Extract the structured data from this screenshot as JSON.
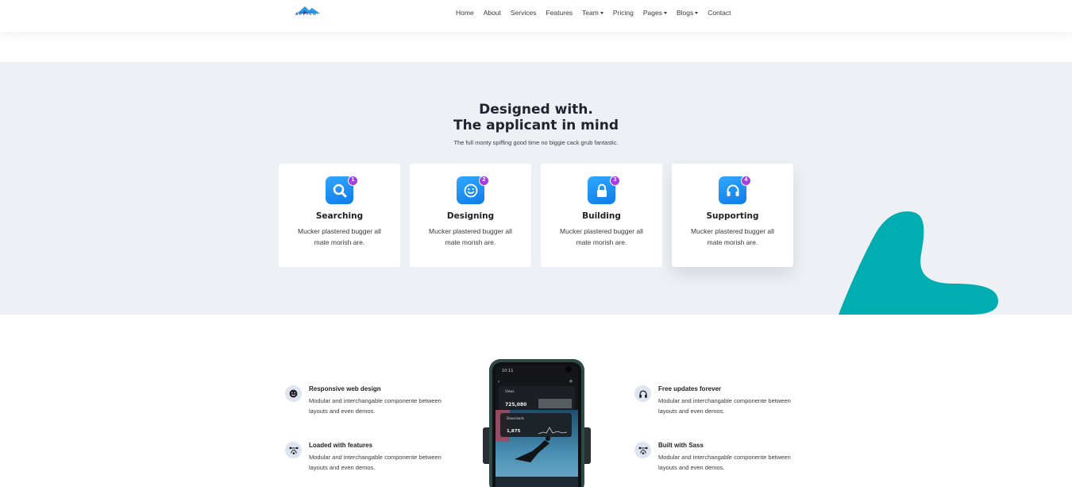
{
  "brand": {
    "logo_text": "APPICO"
  },
  "nav": {
    "items": [
      {
        "label": "Home",
        "dropdown": false
      },
      {
        "label": "About",
        "dropdown": false
      },
      {
        "label": "Services",
        "dropdown": false
      },
      {
        "label": "Features",
        "dropdown": false
      },
      {
        "label": "Team",
        "dropdown": true
      },
      {
        "label": "Pricing",
        "dropdown": false
      },
      {
        "label": "Pages",
        "dropdown": true
      },
      {
        "label": "Blogs",
        "dropdown": true
      },
      {
        "label": "Contact",
        "dropdown": false
      }
    ]
  },
  "section": {
    "heading_line1": "Designed with.",
    "heading_line2": "The applicant in mind",
    "subheading": "The full monty spiffing good time no biggie cack grub fantastic."
  },
  "cards": [
    {
      "badge": "1",
      "icon": "search-icon",
      "title": "Searching",
      "desc": "Mucker plastered bugger all mate morish are."
    },
    {
      "badge": "2",
      "icon": "smiley-icon",
      "title": "Designing",
      "desc": "Mucker plastered bugger all mate morish are."
    },
    {
      "badge": "3",
      "icon": "lock-icon",
      "title": "Building",
      "desc": "Mucker plastered bugger all mate morish are."
    },
    {
      "badge": "4",
      "icon": "headphones-icon",
      "title": "Supporting",
      "desc": "Mucker plastered bugger all mate morish are."
    }
  ],
  "features": {
    "left": [
      {
        "icon": "smiley-icon",
        "title": "Responsive web design",
        "desc": "Modular and interchangable componente between layouts and even demos."
      },
      {
        "icon": "vector-icon",
        "title": "Loaded with features",
        "desc": "Modular and interchangable componente between layouts and even demos."
      }
    ],
    "right": [
      {
        "icon": "headphones-icon",
        "title": "Free updates forever",
        "desc": "Modular and interchangable componente between layouts and even demos."
      },
      {
        "icon": "vector-icon",
        "title": "Built with Sass",
        "desc": "Modular and interchangable componente between layouts and even demos."
      }
    ]
  },
  "phone": {
    "time": "10:11",
    "views_label": "Views",
    "views_value": "725,080",
    "downloads_label": "Downloads",
    "downloads_value": "1,875"
  },
  "colors": {
    "accent_blue": "#1a8cf0",
    "badge_purple": "#a53de0",
    "blob_teal": "#00adb0",
    "section_bg": "#edf0f5"
  }
}
